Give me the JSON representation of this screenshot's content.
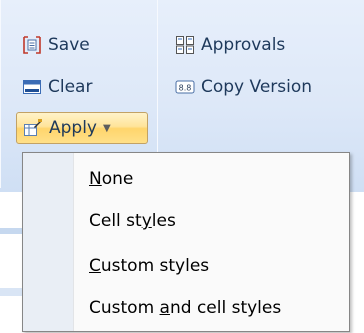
{
  "ribbon": {
    "buttons": {
      "save": "Save",
      "clear": "Clear",
      "apply": "Apply",
      "approvals": "Approvals",
      "copy_version": "Copy Version"
    }
  },
  "menu": {
    "items": [
      {
        "pre": "",
        "u": "N",
        "post": "one"
      },
      {
        "pre": "Cell st",
        "u": "y",
        "post": "les"
      },
      {
        "pre": "",
        "u": "C",
        "post": "ustom styles"
      },
      {
        "pre": "Custom ",
        "u": "a",
        "post": "nd cell styles"
      }
    ]
  },
  "colors": {
    "ribbon_bg": "#dde8f8",
    "hover_gold": "#ffd56c",
    "menu_gutter": "#e9eef5",
    "text": "#1e395b"
  },
  "icons": [
    "save-icon",
    "clear-icon",
    "apply-icon",
    "approvals-icon",
    "copy-version-icon",
    "dropdown-caret-icon"
  ]
}
